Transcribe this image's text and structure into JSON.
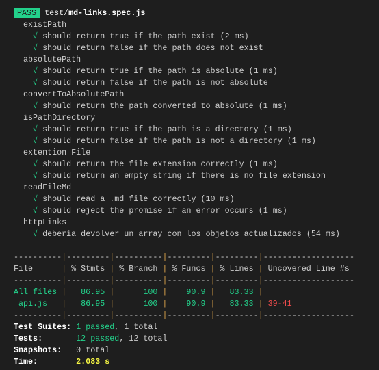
{
  "header": {
    "status": "PASS",
    "file_dir": "test/",
    "file_name": "md-links.spec.js"
  },
  "check_icon": "√",
  "suites": [
    {
      "name": "existPath",
      "tests": [
        "should return true if the path exist (2 ms)",
        "should return false if the path does not exist"
      ]
    },
    {
      "name": "absolutePath",
      "tests": [
        "should return true if the path is absolute (1 ms)",
        "should return false if the path is not absolute"
      ]
    },
    {
      "name": "convertToAbsolutePath",
      "tests": [
        "should return the path converted to absolute (1 ms)"
      ]
    },
    {
      "name": "isPathDirectory",
      "tests": [
        "should return true if the path is a directory (1 ms)",
        "should return false if the path is not a directory (1 ms)"
      ]
    },
    {
      "name": "extention File",
      "tests": [
        "should return the file extension correctly (1 ms)",
        "should return an empty string if there is no file extension"
      ]
    },
    {
      "name": "readFileMd",
      "tests": [
        "should read a .md file correctly (10 ms)",
        "should reject the promise if an error occurs (1 ms)"
      ]
    },
    {
      "name": "httpLinks",
      "tests": [
        "debería devolver un array con los objetos actualizados (54 ms)"
      ]
    }
  ],
  "coverage": {
    "headers": [
      "File",
      "% Stmts",
      "% Branch",
      "% Funcs",
      "% Lines",
      "Uncovered Line #s"
    ],
    "rows": [
      [
        "All files",
        "86.95",
        "100",
        "90.9",
        "83.33",
        ""
      ],
      [
        " api.js",
        "86.95",
        "100",
        "90.9",
        "83.33",
        "39-41"
      ]
    ]
  },
  "summary": {
    "suites_label": "Test Suites:",
    "suites_passed": "1 passed",
    "suites_total": ", 1 total",
    "tests_label": "Tests:",
    "tests_passed": "12 passed",
    "tests_total": ", 12 total",
    "snapshots_label": "Snapshots:",
    "snapshots_value": "0 total",
    "time_label": "Time:",
    "time_value": "2.083 s"
  }
}
